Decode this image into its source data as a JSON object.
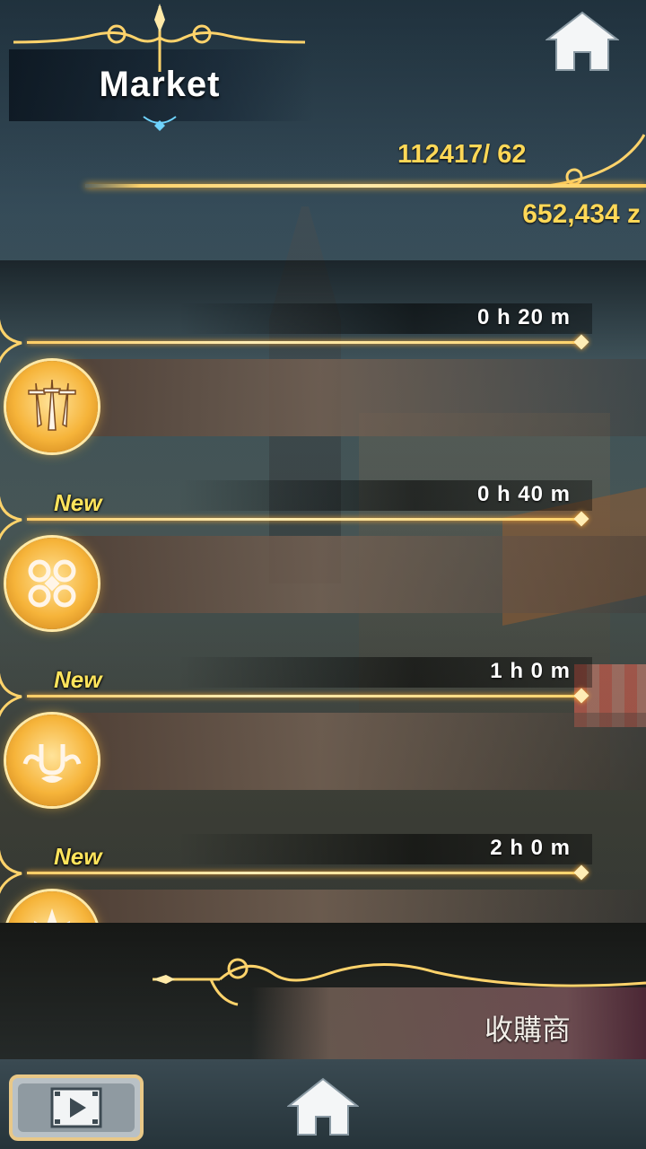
{
  "header": {
    "title": "Market",
    "quota": "112417/ 62",
    "money": "652,434 z",
    "home_icon": "home-icon"
  },
  "slots": [
    {
      "timer": "0 h 20 m",
      "new_label": "",
      "icon": "triple-swords-icon"
    },
    {
      "timer": "0 h 40 m",
      "new_label": "New",
      "icon": "knot-emblem-icon"
    },
    {
      "timer": "1 h 0 m",
      "new_label": "New",
      "icon": "horseshoe-emblem-icon"
    },
    {
      "timer": "2 h 0 m",
      "new_label": "New",
      "icon": "fleur-emblem-icon"
    }
  ],
  "buyer": {
    "label": "收購商"
  },
  "bottom": {
    "video_icon": "video-play-icon",
    "home_icon": "home-icon"
  },
  "colors": {
    "gold": "#ffd857",
    "new_yellow": "#ffe45c",
    "badge_orange": "#f6b43a"
  }
}
